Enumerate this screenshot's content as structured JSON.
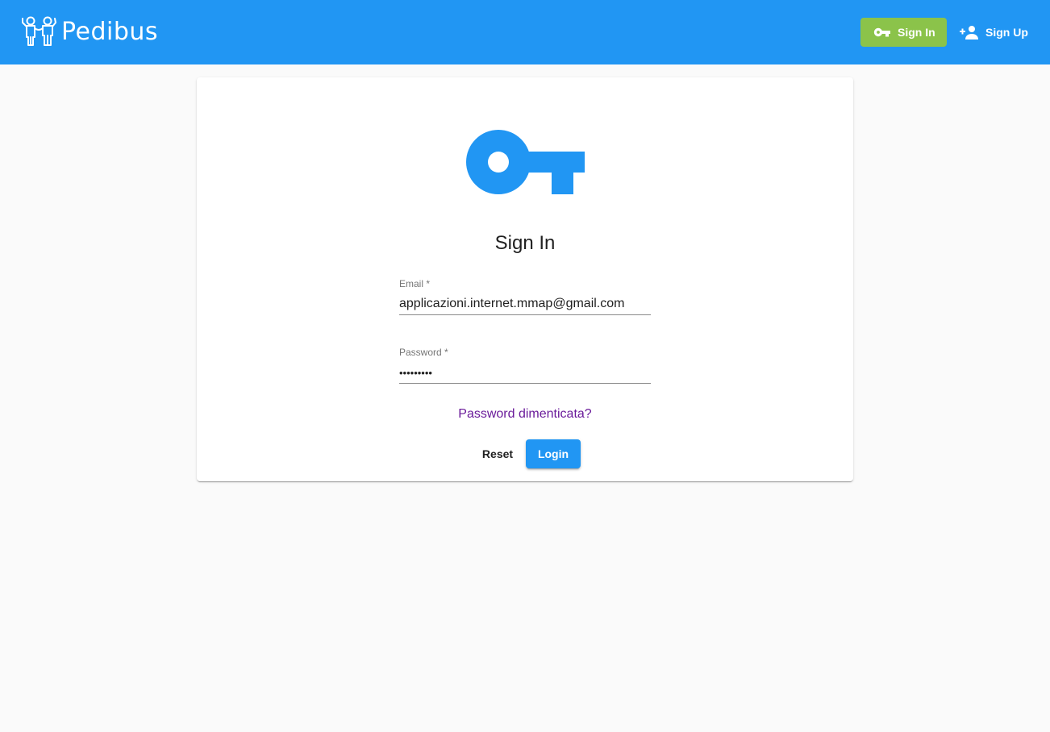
{
  "app": {
    "name": "Pedibus",
    "logo_icon": "children-holding-hands-icon"
  },
  "nav": {
    "sign_in_label": "Sign In",
    "sign_in_icon": "key-icon",
    "sign_up_label": "Sign Up",
    "sign_up_icon": "person-add-icon"
  },
  "form": {
    "icon": "key-icon",
    "title": "Sign In",
    "email_label": "Email *",
    "email_value": "applicazioni.internet.mmap@gmail.com",
    "password_label": "Password *",
    "password_value": "•••••••••",
    "forgot_link": "Password dimenticata?",
    "reset_label": "Reset",
    "login_label": "Login"
  },
  "colors": {
    "primary": "#2196f3",
    "accent": "#8bc34a",
    "link": "#6a1b9a",
    "background": "#fafafa"
  }
}
